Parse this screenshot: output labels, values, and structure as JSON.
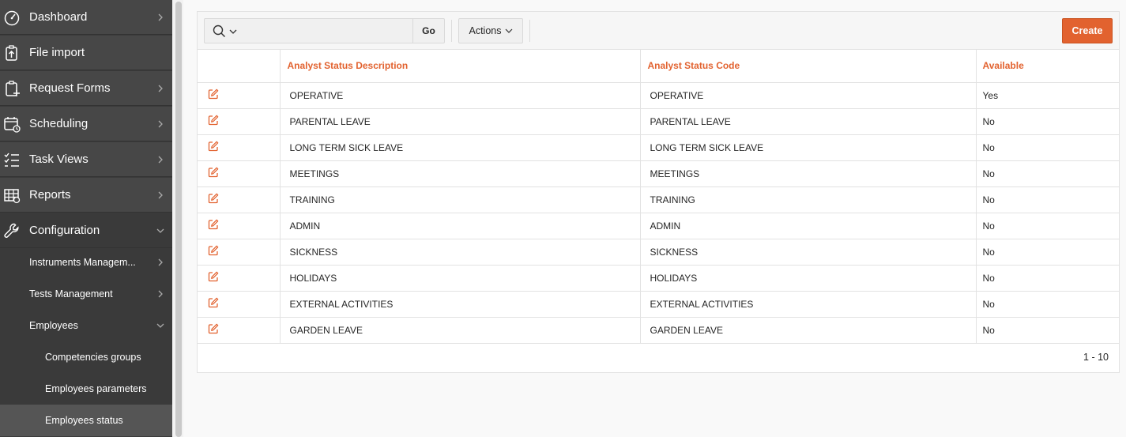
{
  "sidebar": {
    "items": [
      {
        "label": "Dashboard",
        "icon": "dashboard-icon"
      },
      {
        "label": "File import",
        "icon": "file-import-icon"
      },
      {
        "label": "Request Forms",
        "icon": "request-forms-icon"
      },
      {
        "label": "Scheduling",
        "icon": "scheduling-icon"
      },
      {
        "label": "Task Views",
        "icon": "task-views-icon"
      },
      {
        "label": "Reports",
        "icon": "reports-icon"
      },
      {
        "label": "Configuration",
        "icon": "wrench-icon"
      }
    ],
    "sub_items": [
      {
        "label": "Instruments Managem..."
      },
      {
        "label": "Tests Management"
      },
      {
        "label": "Employees"
      }
    ],
    "sub2_items": [
      {
        "label": "Competencies groups"
      },
      {
        "label": "Employees parameters"
      },
      {
        "label": "Employees status"
      }
    ]
  },
  "toolbar": {
    "search_value": "",
    "go_label": "Go",
    "actions_label": "Actions",
    "create_label": "Create"
  },
  "table": {
    "headers": [
      "Analyst Status Description",
      "Analyst Status Code",
      "Available"
    ],
    "rows": [
      [
        "OPERATIVE",
        "OPERATIVE",
        "Yes"
      ],
      [
        "PARENTAL LEAVE",
        "PARENTAL LEAVE",
        "No"
      ],
      [
        "LONG TERM SICK LEAVE",
        "LONG TERM SICK LEAVE",
        "No"
      ],
      [
        "MEETINGS",
        "MEETINGS",
        "No"
      ],
      [
        "TRAINING",
        "TRAINING",
        "No"
      ],
      [
        "ADMIN",
        "ADMIN",
        "No"
      ],
      [
        "SICKNESS",
        "SICKNESS",
        "No"
      ],
      [
        "HOLIDAYS",
        "HOLIDAYS",
        "No"
      ],
      [
        "EXTERNAL ACTIVITIES",
        "EXTERNAL ACTIVITIES",
        "No"
      ],
      [
        "GARDEN LEAVE",
        "GARDEN LEAVE",
        "No"
      ]
    ],
    "pagination": "1 - 10"
  },
  "colors": {
    "accent": "#e2622f",
    "sidebar_bg": "#474747",
    "sidebar_active": "#555555"
  }
}
